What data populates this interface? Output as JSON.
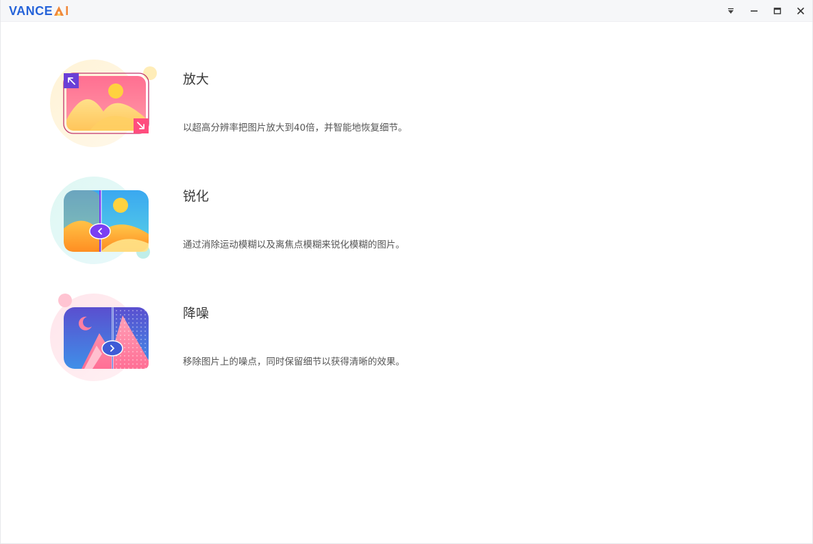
{
  "app": {
    "logo_text": "VANCE",
    "logo_ai_i": "I"
  },
  "window_controls": {
    "menu": "dropdown-icon",
    "minimize": "minimize-icon",
    "maximize": "maximize-icon",
    "close": "close-icon"
  },
  "features": [
    {
      "title": "放大",
      "description": "以超高分辨率把图片放大到40倍，并智能地恢复细节。",
      "icon": "enlarge-image-icon"
    },
    {
      "title": "锐化",
      "description": "通过消除运动模糊以及离焦点模糊来锐化模糊的图片。",
      "icon": "sharpen-image-icon"
    },
    {
      "title": "降噪",
      "description": "移除图片上的噪点，同时保留细节以获得清晰的效果。",
      "icon": "denoise-image-icon"
    }
  ],
  "colors": {
    "brand_blue": "#2563d9",
    "brand_orange": "#f0883a",
    "enlarge_accent": "#ff5f86",
    "sharpen_accent": "#7b3ff2",
    "denoise_accent": "#3f5bd6"
  }
}
